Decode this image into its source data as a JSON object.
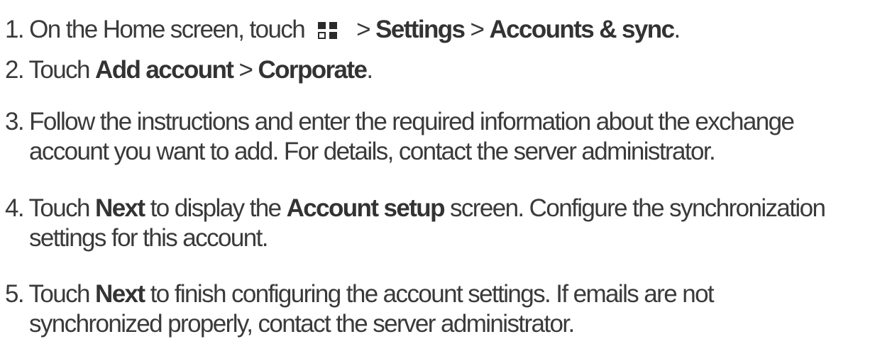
{
  "steps": [
    {
      "num": "1.",
      "pre": " On the Home screen, touch",
      "icon": "apps-grid-icon",
      "mid1": "> ",
      "b1": "Settings",
      "mid2": " > ",
      "b2": "Accounts & sync",
      "post": "."
    },
    {
      "num": "2.",
      "pre": " Touch ",
      "b1": "Add account",
      "mid": " > ",
      "b2": "Corporate",
      "post": "."
    },
    {
      "num": "3.",
      "line1": " Follow the instructions and enter the required information about the exchange",
      "line2": "account you want to add. For details, contact the server administrator."
    },
    {
      "num": "4.",
      "pre": " Touch ",
      "b1": "Next",
      "mid": " to display the ",
      "b2": "Account setup",
      "post": " screen. Configure the synchronization",
      "line2": "settings for this account."
    },
    {
      "num": "5.",
      "pre": " Touch ",
      "b1": "Next",
      "post": " to finish configuring the account settings. If emails are not",
      "line2": "synchronized properly, contact the server administrator."
    }
  ]
}
